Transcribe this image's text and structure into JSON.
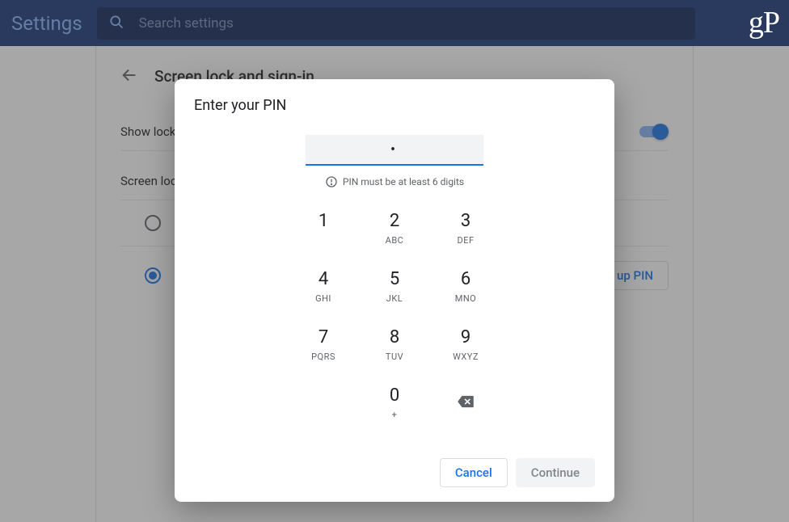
{
  "header": {
    "title": "Settings",
    "search_placeholder": "Search settings"
  },
  "watermark": "gP",
  "page": {
    "title": "Screen lock and sign-in",
    "show_lock_label": "Show lock screen when waking from sleep",
    "screen_lock_heading": "Screen lock options",
    "setup_pin_label": "Set up PIN",
    "setup_pin_visible_fragment": "up PIN"
  },
  "modal": {
    "title": "Enter your PIN",
    "pin_value": "•",
    "hint": "PIN must be at least 6 digits",
    "keys": [
      {
        "num": "1",
        "sub": ""
      },
      {
        "num": "2",
        "sub": "ABC"
      },
      {
        "num": "3",
        "sub": "DEF"
      },
      {
        "num": "4",
        "sub": "GHI"
      },
      {
        "num": "5",
        "sub": "JKL"
      },
      {
        "num": "6",
        "sub": "MNO"
      },
      {
        "num": "7",
        "sub": "PQRS"
      },
      {
        "num": "8",
        "sub": "TUV"
      },
      {
        "num": "9",
        "sub": "WXYZ"
      },
      {
        "num": "",
        "sub": ""
      },
      {
        "num": "0",
        "sub": "+"
      },
      {
        "num": "backspace",
        "sub": ""
      }
    ],
    "cancel": "Cancel",
    "continue": "Continue"
  }
}
